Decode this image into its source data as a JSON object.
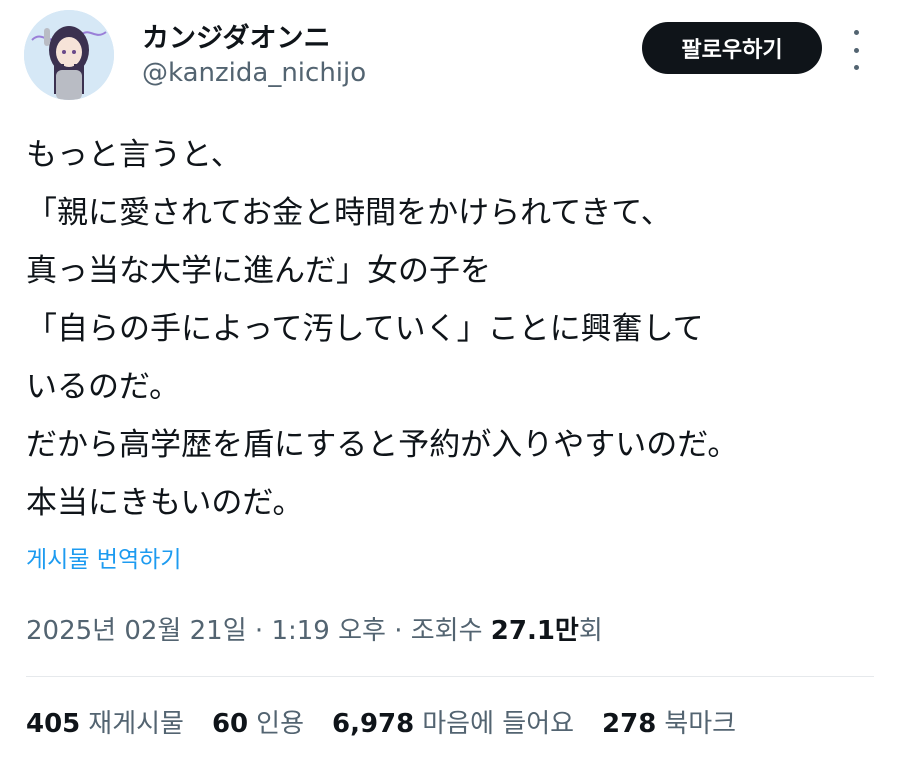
{
  "author": {
    "display_name": "カンジダオンニ",
    "handle": "@kanzida_nichijo"
  },
  "follow_label": "팔로우하기",
  "post": {
    "lines": [
      "もっと言うと、",
      "「親に愛されてお金と時間をかけられてきて、",
      "真っ当な大学に進んだ」女の子を",
      "「自らの手によって汚していく」ことに興奮して",
      "いるのだ。",
      "だから高学歴を盾にすると予約が入りやすいのだ。",
      "本当にきもいのだ。"
    ]
  },
  "translate_label": "게시물 번역하기",
  "meta": {
    "date": "2025년 02월 21일",
    "separator": " · ",
    "time": "1:19 오후",
    "views_label": "조회수",
    "views_value": "27.1만",
    "views_suffix": "회"
  },
  "stats": [
    {
      "value": "405",
      "label": "재게시물"
    },
    {
      "value": "60",
      "label": "인용"
    },
    {
      "value": "6,978",
      "label": "마음에 들어요"
    },
    {
      "value": "278",
      "label": "북마크"
    }
  ],
  "colors": {
    "text": "#0f1419",
    "muted": "#536471",
    "link": "#1d9bf0",
    "button_bg": "#0f1419",
    "divider": "#e6e9ec"
  },
  "icons": {
    "more": "more-vertical-icon"
  }
}
